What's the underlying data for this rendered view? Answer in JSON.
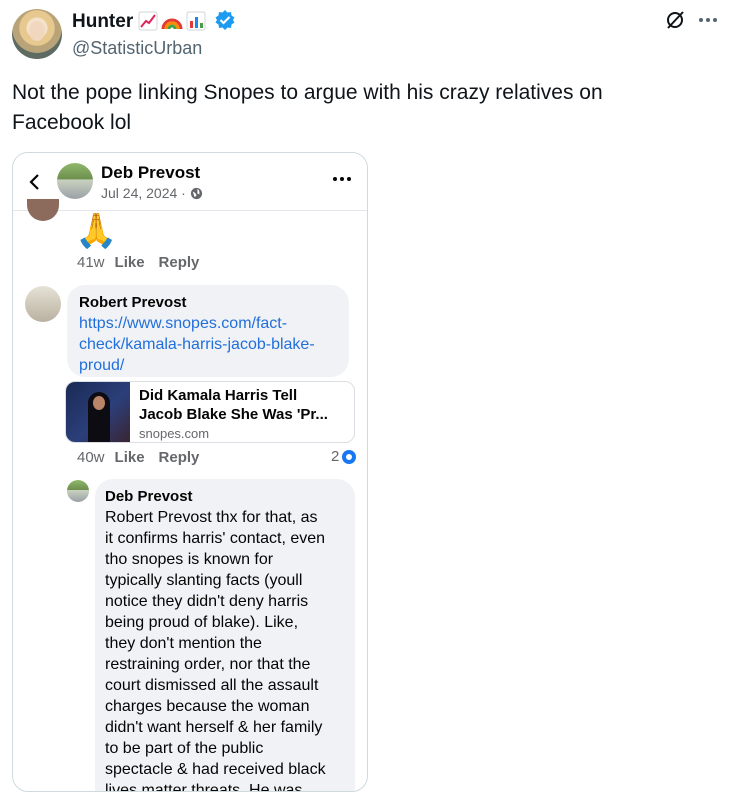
{
  "tweet": {
    "display_name": "Hunter",
    "name_emojis": [
      "chart-increasing-icon",
      "rainbow-icon",
      "bar-chart-icon"
    ],
    "handle": "@StatisticUrban",
    "text": "Not the pope linking Snopes to argue with his crazy relatives on Facebook lol",
    "colors": {
      "verified": "#1d9bf0",
      "handle": "#536471"
    }
  },
  "facebook": {
    "header": {
      "name": "Deb Prevost",
      "date": "Jul 24, 2024 ·"
    },
    "first_reply": {
      "emoji": "🙏",
      "age": "41w",
      "like": "Like",
      "reply": "Reply"
    },
    "comment": {
      "author": "Robert Prevost",
      "link": "https://www.snopes.com/fact-check/kamala-harris-jacob-blake-proud/",
      "link_lines": [
        "https://www.snopes.com/fact-",
        "check/kamala-harris-jacob-blake-",
        "proud/"
      ],
      "card": {
        "title_line1": "Did Kamala Harris Tell",
        "title_line2": "Jacob Blake She Was 'Pr...",
        "domain": "snopes.com"
      },
      "age": "40w",
      "like": "Like",
      "reply": "Reply",
      "reaction_count": "2"
    },
    "nested_reply": {
      "author": "Deb Prevost",
      "lines": [
        "Robert Prevost thx for that, as",
        "it confirms harris' contact, even",
        "tho snopes is known for",
        "typically slanting facts (youll",
        "notice they didn't deny harris",
        "being proud of blake). Like,",
        "they don't mention the",
        "restraining order, nor that the",
        "court dismissed all the assault",
        "charges because the woman",
        "didn't want herself & her family",
        "to be part of the public",
        "spectacle & had received black",
        "lives matter threats.  He was"
      ]
    },
    "colors": {
      "link": "#216fdb",
      "bubble": "#f0f2f5",
      "meta": "#65676b",
      "like_badge": "#1877f2"
    }
  }
}
